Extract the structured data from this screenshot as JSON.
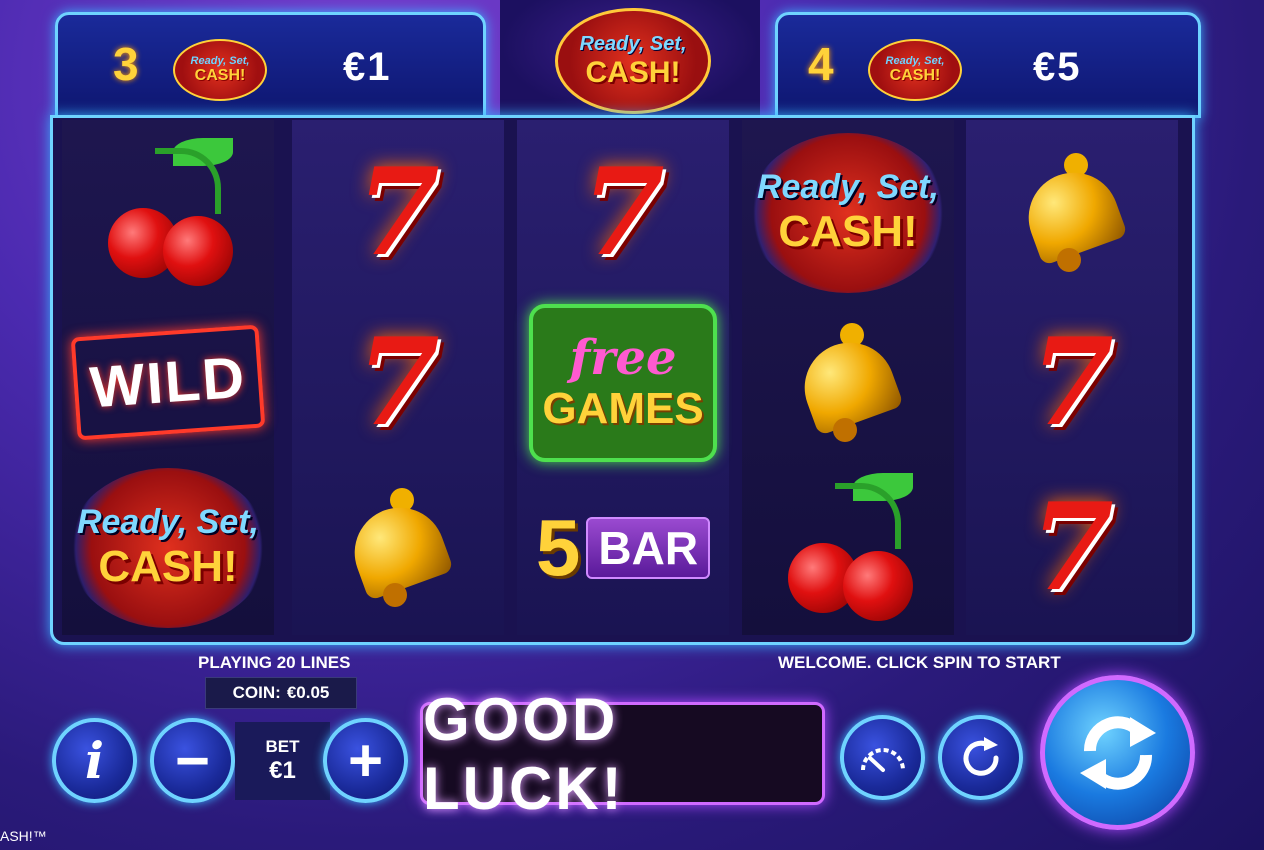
{
  "jackpots": {
    "left": {
      "count": "3",
      "logo_top": "Ready, Set,",
      "logo_bottom": "CASH!",
      "prize": "€1"
    },
    "right": {
      "count": "4",
      "logo_top": "Ready, Set,",
      "logo_bottom": "CASH!",
      "prize": "€5"
    }
  },
  "title_logo": {
    "top": "Ready, Set,",
    "bottom": "CASH!"
  },
  "reels": [
    [
      "cherry",
      "wild",
      "ready-set-cash"
    ],
    [
      "seven",
      "seven",
      "bell"
    ],
    [
      "seven",
      "free-games",
      "5-bar"
    ],
    [
      "ready-set-cash",
      "bell",
      "cherry"
    ],
    [
      "bell",
      "seven",
      "seven"
    ]
  ],
  "symbols": {
    "seven": "7",
    "wild": "WILD",
    "free_top": "free",
    "free_bottom": "GAMES",
    "bar_num": "5",
    "bar_text": "BAR",
    "rsc_top": "Ready, Set,",
    "rsc_bottom": "CASH!"
  },
  "info": {
    "lines_text": "PLAYING 20 LINES",
    "welcome_text": "WELCOME. CLICK SPIN TO START",
    "coin_label": "COIN:",
    "coin_value": "€0.05"
  },
  "controls": {
    "info_icon": "i",
    "minus_icon": "−",
    "plus_icon": "+",
    "bet_label": "BET",
    "bet_value": "€1",
    "message": "GOOD LUCK!",
    "turbo_icon": "speedometer-icon",
    "autoplay_icon": "autoplay-icon",
    "spin_icon": "spin-icon"
  },
  "footer": {
    "text": "ASH!™"
  },
  "colors": {
    "accent": "#6fd3ff",
    "glow_purple": "#d06aff",
    "gold": "#ffd23a",
    "red": "#e81a14"
  }
}
